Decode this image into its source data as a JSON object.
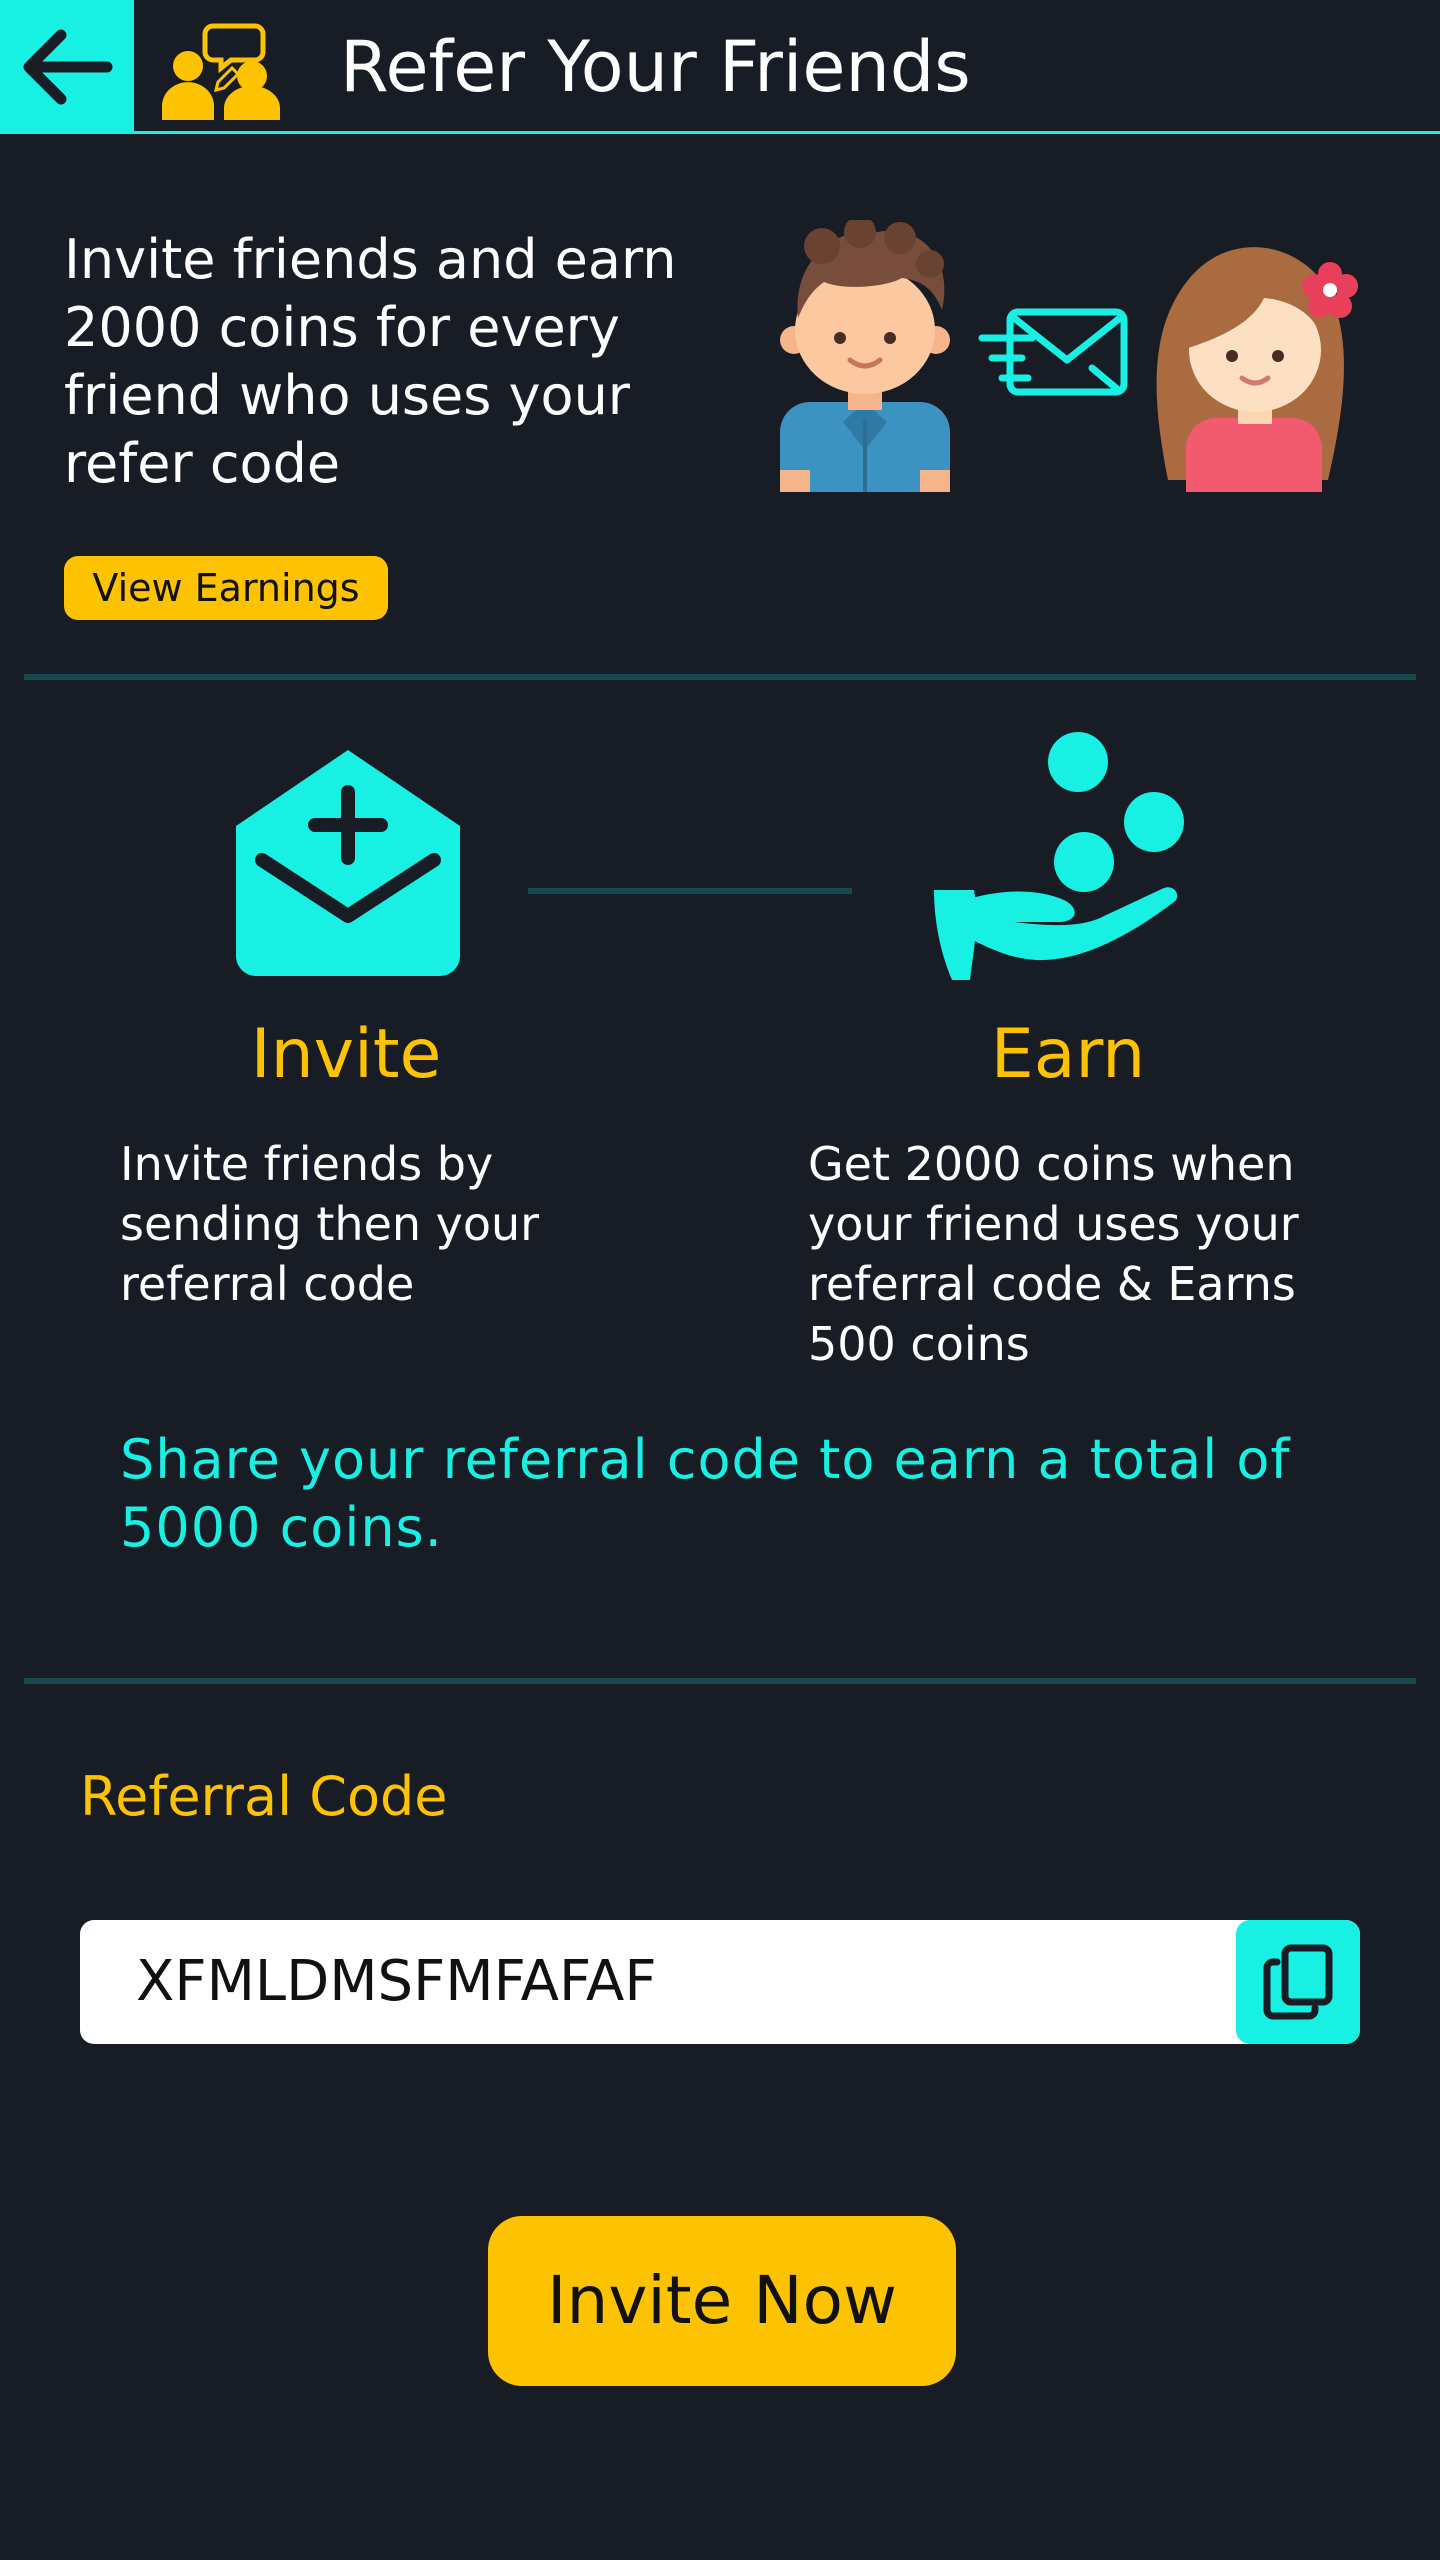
{
  "header": {
    "title": "Refer Your Friends",
    "back_icon": "arrow-left-icon",
    "app_icon": "refer-friends-icon"
  },
  "intro": {
    "text": "Invite friends and earn 2000 coins for every friend who uses your refer code",
    "illustration": "friends-sharing-message-illustration",
    "view_earnings_label": "View Earnings"
  },
  "steps": [
    {
      "icon": "envelope-plus-icon",
      "title": "Invite",
      "description": "Invite friends by sending then your referral code"
    },
    {
      "icon": "hand-coins-icon",
      "title": "Earn",
      "description": "Get 2000 coins when your friend uses your referral code & Earns 500 coins"
    }
  ],
  "share_text": "Share your referral code to earn a total of 5000 coins.",
  "referral": {
    "label": "Referral Code",
    "code": "XFMLDMSFMFAFAF",
    "copy_icon": "copy-icon"
  },
  "invite_button_label": "Invite Now",
  "colors": {
    "background": "#181d25",
    "accent": "#17f0e3",
    "highlight": "#fec300",
    "divider": "#16484d"
  }
}
